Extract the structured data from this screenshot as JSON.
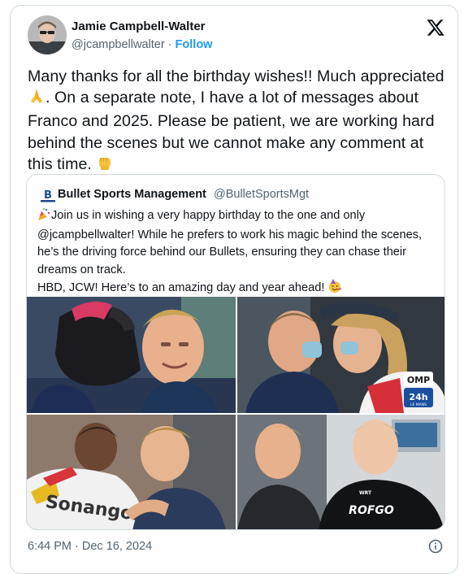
{
  "tweet": {
    "author_name": "Jamie Campbell-Walter",
    "author_handle": "@jcampbellwalter",
    "separator": " · ",
    "follow_label": "Follow",
    "text_part1": "Many thanks for all the birthday wishes!! Much appreciated ",
    "text_part2": ". On a separate note, I have a lot of messages about Franco and 2025. Please be patient, we are working hard behind the scenes but we cannot make any comment at this time. ",
    "timestamp": "6:44 PM · Dec 16, 2024"
  },
  "quote": {
    "author_name": "Bullet Sports Management",
    "author_handle": "@BulletSportsMgt",
    "line1": "Join us in wishing a very happy birthday to the one and only @jcampbellwalter! While he prefers to work his magic behind the scenes, he’s the driving force behind our Bullets, ensuring they can chase their dreams on track.",
    "line2": "HBD, JCW! Here’s to an amazing day and year ahead! ",
    "photo_texts": {
      "brand1": "OMP",
      "brand2": "24h",
      "brand2_sub": "LE MANS",
      "brand3": "Sonangol",
      "brand4": "ROFGO",
      "brand4_sub": "WRT"
    }
  },
  "icons": [
    "x-logo-icon",
    "bullet-logo-icon",
    "info-icon",
    "praying-hands-emoji-icon",
    "fist-emoji-icon",
    "party-popper-emoji-icon",
    "party-face-emoji-icon"
  ],
  "colors": {
    "link": "#1d9bf0",
    "secondary_text": "#536471",
    "border": "#cfd9de",
    "text": "#0f1419"
  }
}
